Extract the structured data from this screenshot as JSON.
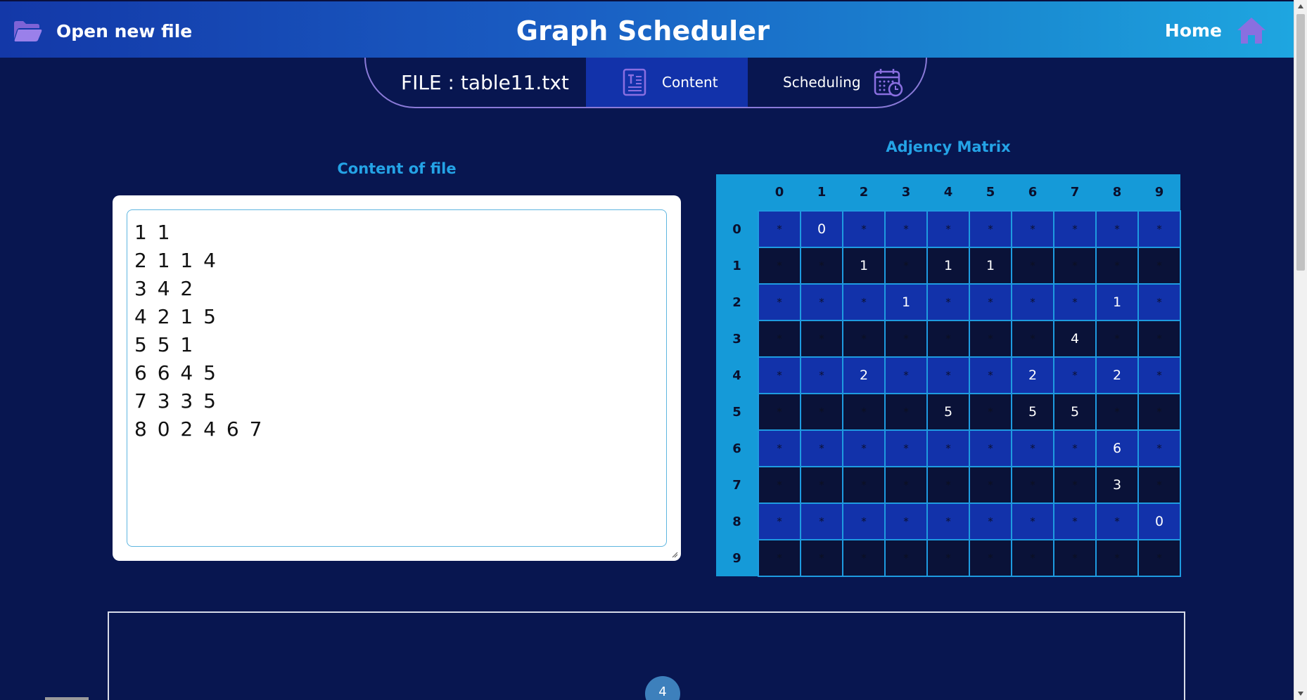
{
  "header": {
    "open_file_label": "Open new file",
    "app_title": "Graph Scheduler",
    "home_label": "Home"
  },
  "tabs": {
    "file_label": "FILE : table11.txt",
    "content_label": "Content",
    "scheduling_label": "Scheduling"
  },
  "file_section": {
    "title": "Content of file",
    "text": "1 1\n2 1 1 4\n3 4 2\n4 2 1 5\n5 5 1\n6 6 4 5\n7 3 3 5\n8 0 2 4 6 7"
  },
  "matrix": {
    "title": "Adjency Matrix",
    "headers": [
      "0",
      "1",
      "2",
      "3",
      "4",
      "5",
      "6",
      "7",
      "8",
      "9"
    ],
    "rows": [
      {
        "label": "0",
        "cells": [
          "*",
          "0",
          "*",
          "*",
          "*",
          "*",
          "*",
          "*",
          "*",
          "*"
        ]
      },
      {
        "label": "1",
        "cells": [
          "*",
          "*",
          "1",
          "*",
          "1",
          "1",
          "*",
          "*",
          "*",
          "*"
        ]
      },
      {
        "label": "2",
        "cells": [
          "*",
          "*",
          "*",
          "1",
          "*",
          "*",
          "*",
          "*",
          "1",
          "*"
        ]
      },
      {
        "label": "3",
        "cells": [
          "*",
          "*",
          "*",
          "*",
          "*",
          "*",
          "*",
          "4",
          "*",
          "*"
        ]
      },
      {
        "label": "4",
        "cells": [
          "*",
          "*",
          "2",
          "*",
          "*",
          "*",
          "2",
          "*",
          "2",
          "*"
        ]
      },
      {
        "label": "5",
        "cells": [
          "*",
          "*",
          "*",
          "*",
          "5",
          "*",
          "5",
          "5",
          "*",
          "*"
        ]
      },
      {
        "label": "6",
        "cells": [
          "*",
          "*",
          "*",
          "*",
          "*",
          "*",
          "*",
          "*",
          "6",
          "*"
        ]
      },
      {
        "label": "7",
        "cells": [
          "*",
          "*",
          "*",
          "*",
          "*",
          "*",
          "*",
          "*",
          "3",
          "*"
        ]
      },
      {
        "label": "8",
        "cells": [
          "*",
          "*",
          "*",
          "*",
          "*",
          "*",
          "*",
          "*",
          "*",
          "0"
        ]
      },
      {
        "label": "9",
        "cells": [
          "*",
          "*",
          "*",
          "*",
          "*",
          "*",
          "*",
          "*",
          "*",
          "*"
        ]
      }
    ]
  },
  "graph": {
    "visible_node_label": "4"
  },
  "icons": {
    "open_file": "folder-open-icon",
    "home": "home-icon",
    "content_tab": "text-document-icon",
    "scheduling_tab": "calendar-clock-icon"
  },
  "colors": {
    "background": "#081650",
    "header_gradient_start": "#1338a8",
    "header_gradient_end": "#1ea6e0",
    "accent_title": "#24a3e6",
    "active_tab": "#1232aa",
    "matrix_header": "#159ad8",
    "icon_purple": "#8a6fe0"
  }
}
